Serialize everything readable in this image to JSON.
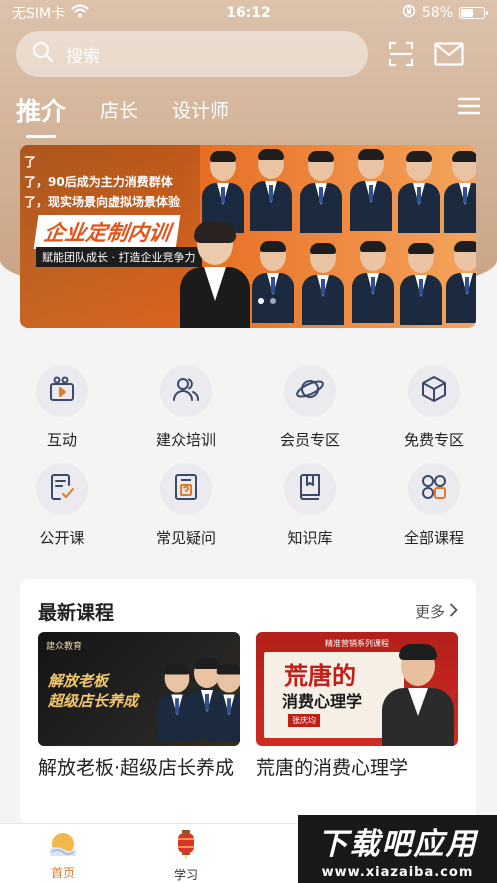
{
  "status_bar": {
    "carrier": "无SIM卡",
    "time": "16:12",
    "battery": "58%",
    "battery_level": 0.58
  },
  "search": {
    "placeholder": "搜索"
  },
  "tabs": [
    {
      "label": "推介",
      "active": true
    },
    {
      "label": "店长",
      "active": false
    },
    {
      "label": "设计师",
      "active": false
    }
  ],
  "banner": {
    "lines": [
      "了，90后成为主力消费群体",
      "了，现实场景向虚拟场景体验",
      "了"
    ],
    "title": "企业定制内训",
    "subtitle": "赋能团队成长 · 打造企业竞争力",
    "active_dot": 0,
    "dot_count": 2
  },
  "quick_links": [
    {
      "label": "互动",
      "icon": "video-camera-icon"
    },
    {
      "label": "建众培训",
      "icon": "users-icon"
    },
    {
      "label": "会员专区",
      "icon": "planet-icon"
    },
    {
      "label": "免费专区",
      "icon": "cube-icon"
    },
    {
      "label": "公开课",
      "icon": "checklist-icon"
    },
    {
      "label": "常见疑问",
      "icon": "question-doc-icon"
    },
    {
      "label": "知识库",
      "icon": "book-icon"
    },
    {
      "label": "全部课程",
      "icon": "grid-icon"
    }
  ],
  "latest": {
    "title": "最新课程",
    "more": "更多",
    "courses": [
      {
        "name": "解放老板·超级店长养成",
        "thumb": {
          "brand": "建众教育",
          "line1": "解放老板",
          "line2": "超级店长养成"
        }
      },
      {
        "name": "荒唐的消费心理学",
        "thumb": {
          "series": "精准营销系列课程",
          "line1": "荒唐的",
          "line2": "消费心理学",
          "speaker": "张庆均"
        }
      }
    ]
  },
  "tabbar": [
    {
      "label": "首页",
      "icon": "home-sun-icon",
      "active": true
    },
    {
      "label": "学习",
      "icon": "lantern-icon",
      "active": false
    }
  ],
  "watermark": {
    "title": "下载吧应用",
    "url": "www.xiazaiba.com"
  },
  "colors": {
    "accent": "#e07b2c",
    "hero": "#c9a283",
    "icon": "#3b4a6b"
  }
}
